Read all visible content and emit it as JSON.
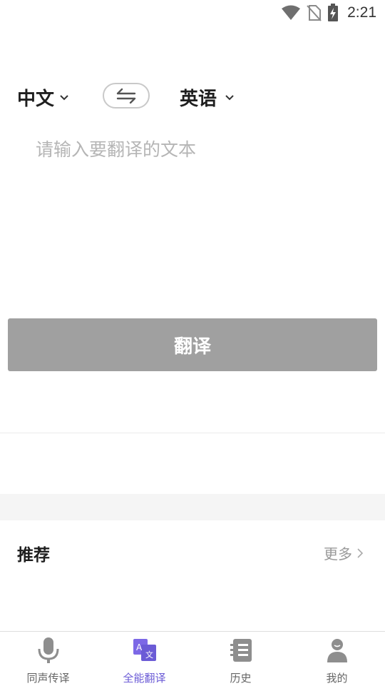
{
  "status_bar": {
    "time": "2:21"
  },
  "languages": {
    "source": "中文",
    "target": "英语"
  },
  "input": {
    "placeholder": "请输入要翻译的文本",
    "value": ""
  },
  "translate_button": {
    "label": "翻译"
  },
  "recommend": {
    "title": "推荐",
    "more_label": "更多"
  },
  "bottom_nav": {
    "items": [
      {
        "label": "同声传译",
        "icon": "microphone-icon",
        "active": false
      },
      {
        "label": "全能翻译",
        "icon": "translate-icon",
        "active": true
      },
      {
        "label": "历史",
        "icon": "history-list-icon",
        "active": false
      },
      {
        "label": "我的",
        "icon": "profile-icon",
        "active": false
      }
    ]
  },
  "colors": {
    "accent": "#6b5bd6",
    "button_disabled": "#a0a0a0",
    "icon_gray": "#8e8e8e"
  }
}
